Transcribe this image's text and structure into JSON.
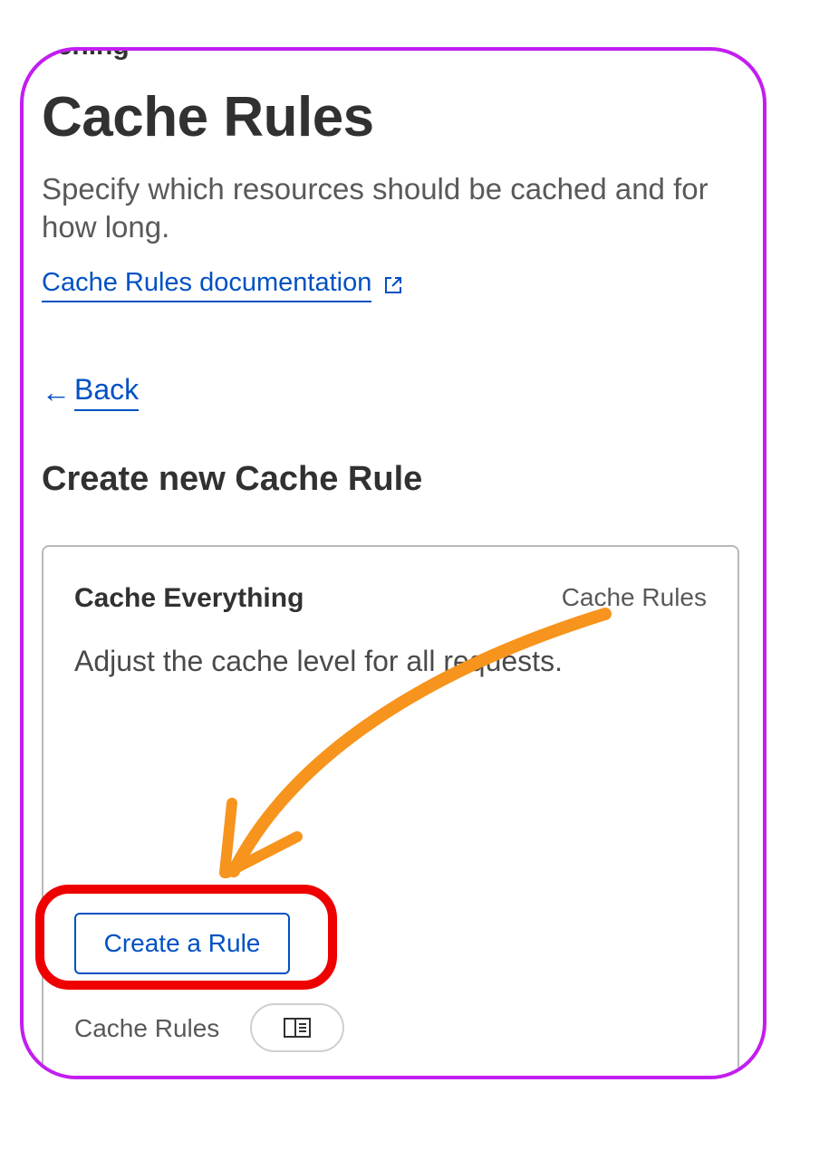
{
  "breadcrumb": "aching",
  "page": {
    "title": "Cache Rules",
    "description": "Specify which resources should be cached and for how long.",
    "doc_link_label": "Cache Rules documentation",
    "back_label": "Back",
    "section_title": "Create new Cache Rule"
  },
  "card": {
    "title": "Cache Everything",
    "tag": "Cache Rules",
    "description": "Adjust the cache level for all requests.",
    "create_button_label": "Create a Rule",
    "footer_label": "Cache Rules"
  },
  "icons": {
    "external_link": "external-link-icon",
    "back_arrow": "arrow-left-icon",
    "book": "book-icon"
  },
  "colors": {
    "frame_border": "#c21ef0",
    "link": "#0051c3",
    "highlight_box": "#ee0000",
    "annotation_arrow": "#f7941d"
  },
  "glyphs": {
    "back_arrow": "←"
  }
}
